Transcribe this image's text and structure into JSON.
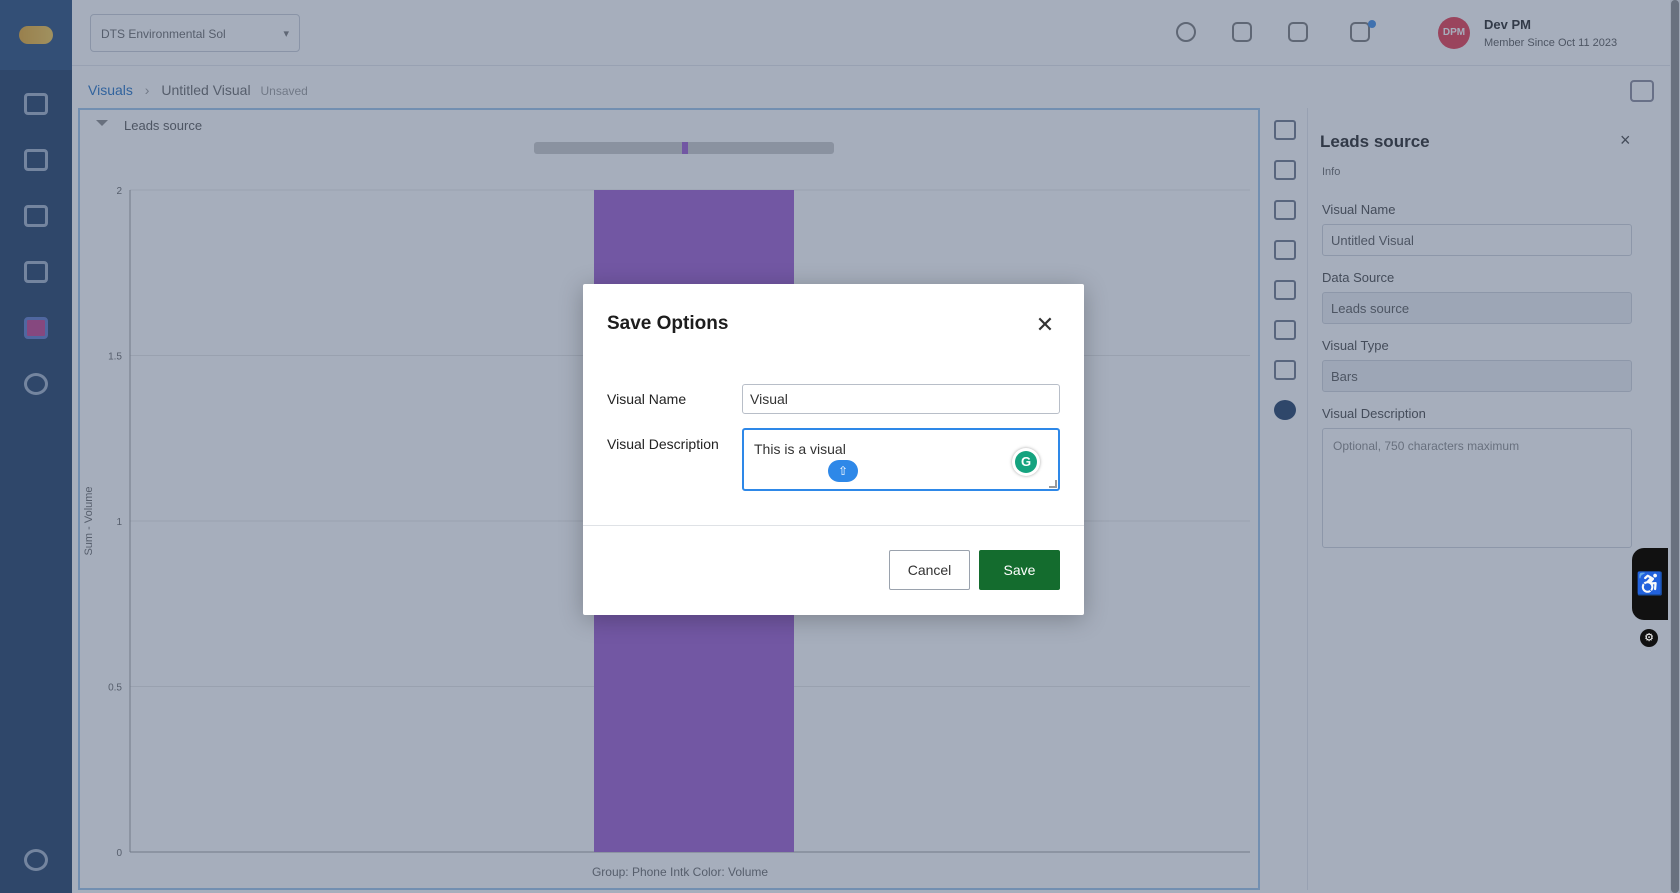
{
  "topbar": {
    "org_select_value": "DTS Environmental Sol",
    "user_name": "Dev PM",
    "user_sub": "Member Since Oct 11 2023",
    "avatar_initials": "DPM"
  },
  "breadcrumb": {
    "root": "Visuals",
    "current": "Untitled Visual",
    "status": "Unsaved"
  },
  "chart": {
    "title": "Leads source",
    "bar_color": "#9b59d0",
    "y_axis_label": "Sum - Volume",
    "footer_group_label": "Group:",
    "footer_group_value": "Phone Intk",
    "footer_color_label": "Color:",
    "footer_color_value": "Volume"
  },
  "chart_data": {
    "type": "bar",
    "categories": [
      ""
    ],
    "values": [
      2
    ],
    "ylim": [
      0,
      2
    ],
    "yticks": [
      0,
      0.5,
      1,
      1.5,
      2
    ],
    "grid": true
  },
  "properties": {
    "title": "Leads source",
    "info": "Info",
    "visual_name_label": "Visual Name",
    "visual_name_value": "Untitled Visual",
    "data_source_label": "Data Source",
    "data_source_value": "Leads source",
    "visual_type_label": "Visual Type",
    "visual_type_value": "Bars",
    "visual_description_label": "Visual Description",
    "visual_description_placeholder": "Optional, 750 characters maximum"
  },
  "modal": {
    "title": "Save Options",
    "close_symbol": "✕",
    "visual_name_label": "Visual Name",
    "visual_name_value": "Visual",
    "visual_description_label": "Visual Description",
    "visual_description_value": "This is a visual",
    "grammarly_letter": "G",
    "cancel_label": "Cancel",
    "save_label": "Save",
    "save_color": "#146c2e"
  },
  "widgets": {
    "a11y_symbol": "♿",
    "gear_symbol": "⚙"
  }
}
